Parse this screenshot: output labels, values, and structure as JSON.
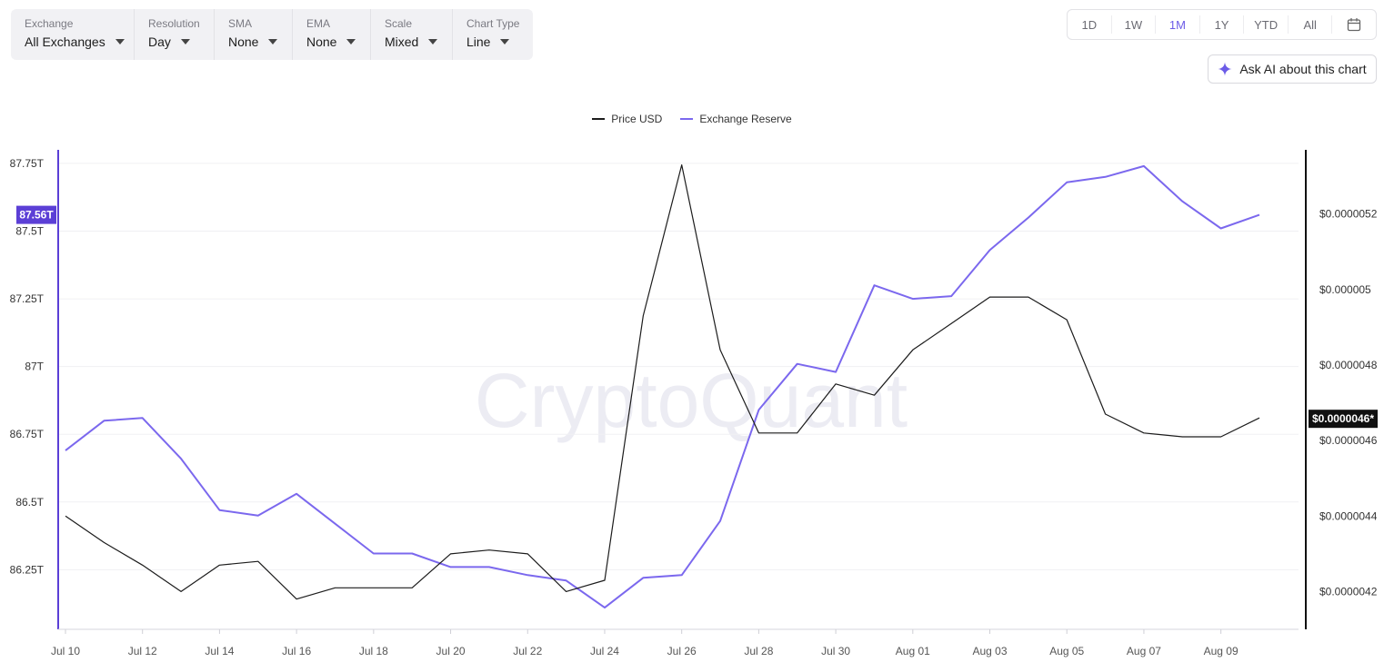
{
  "toolbar": {
    "controls": [
      {
        "label": "Exchange",
        "value": "All Exchanges"
      },
      {
        "label": "Resolution",
        "value": "Day"
      },
      {
        "label": "SMA",
        "value": "None"
      },
      {
        "label": "EMA",
        "value": "None"
      },
      {
        "label": "Scale",
        "value": "Mixed"
      },
      {
        "label": "Chart Type",
        "value": "Line"
      }
    ]
  },
  "range": {
    "buttons": [
      "1D",
      "1W",
      "1M",
      "1Y",
      "YTD",
      "All"
    ],
    "active": "1M",
    "calendar_icon": "calendar-icon"
  },
  "ask_ai": {
    "label": "Ask AI about this chart",
    "icon": "sparkle-icon",
    "icon_color": "#6c5ce7"
  },
  "watermark": "CryptoQuant",
  "colors": {
    "price": "#1c1c1c",
    "reserve": "#7b68ee",
    "accent": "#6c5ce7",
    "marker_left": "#5b3fd6",
    "marker_right": "#111111"
  },
  "chart_data": {
    "type": "line",
    "legend": {
      "position": "top-center",
      "entries": [
        "Price USD",
        "Exchange Reserve"
      ]
    },
    "x_labels": [
      "Jul 10",
      "Jul 12",
      "Jul 14",
      "Jul 16",
      "Jul 18",
      "Jul 20",
      "Jul 22",
      "Jul 24",
      "Jul 26",
      "Jul 28",
      "Jul 30",
      "Aug 01",
      "Aug 03",
      "Aug 05",
      "Aug 07",
      "Aug 09"
    ],
    "x": [
      "Jul 10",
      "Jul 11",
      "Jul 12",
      "Jul 13",
      "Jul 14",
      "Jul 15",
      "Jul 16",
      "Jul 17",
      "Jul 18",
      "Jul 19",
      "Jul 20",
      "Jul 21",
      "Jul 22",
      "Jul 23",
      "Jul 24",
      "Jul 25",
      "Jul 26",
      "Jul 27",
      "Jul 28",
      "Jul 29",
      "Jul 30",
      "Jul 31",
      "Aug 01",
      "Aug 02",
      "Aug 03",
      "Aug 04",
      "Aug 05",
      "Aug 06",
      "Aug 07",
      "Aug 08",
      "Aug 09",
      "Aug 10"
    ],
    "series": [
      {
        "name": "Exchange Reserve",
        "axis": "left",
        "values": [
          86.69,
          86.8,
          86.81,
          86.66,
          86.47,
          86.45,
          86.53,
          86.42,
          86.31,
          86.31,
          86.26,
          86.26,
          86.23,
          86.21,
          86.11,
          86.22,
          86.23,
          86.43,
          86.84,
          87.01,
          86.98,
          87.3,
          87.25,
          87.26,
          87.43,
          87.55,
          87.68,
          87.7,
          87.74,
          87.61,
          87.51,
          87.56
        ]
      },
      {
        "name": "Price USD",
        "axis": "right",
        "values": [
          4.4e-06,
          4.33e-06,
          4.27e-06,
          4.2e-06,
          4.27e-06,
          4.28e-06,
          4.18e-06,
          4.21e-06,
          4.21e-06,
          4.21e-06,
          4.3e-06,
          4.31e-06,
          4.3e-06,
          4.2e-06,
          4.23e-06,
          4.93e-06,
          5.33e-06,
          4.84e-06,
          4.62e-06,
          4.62e-06,
          4.75e-06,
          4.72e-06,
          4.84e-06,
          4.91e-06,
          4.98e-06,
          4.98e-06,
          4.92e-06,
          4.67e-06,
          4.62e-06,
          4.61e-06,
          4.61e-06,
          4.66e-06
        ]
      }
    ],
    "left_axis": {
      "ticks": [
        "87.75T",
        "87.5T",
        "87.25T",
        "87T",
        "86.75T",
        "86.5T",
        "86.25T"
      ],
      "tick_values": [
        87.75,
        87.5,
        87.25,
        87.0,
        86.75,
        86.5,
        86.25
      ],
      "range": [
        86.03,
        87.8
      ],
      "current": "87.56T"
    },
    "right_axis": {
      "ticks": [
        "$0.0000052",
        "$0.000005",
        "$0.0000048",
        "$0.0000046",
        "$0.0000044",
        "$0.0000042"
      ],
      "tick_values": [
        5.2e-06,
        5e-06,
        4.8e-06,
        4.6e-06,
        4.4e-06,
        4.2e-06
      ],
      "range": [
        4.1e-06,
        5.37e-06
      ],
      "current": "$0.0000046*"
    },
    "grid": true
  }
}
